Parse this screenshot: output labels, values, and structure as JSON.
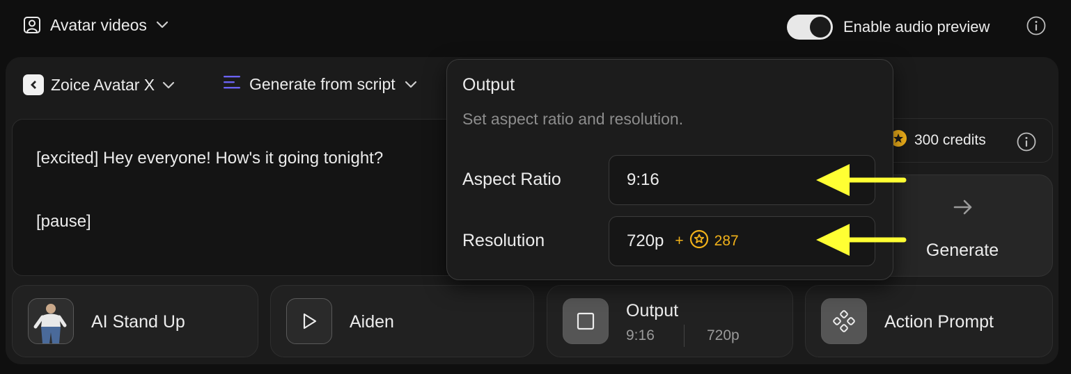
{
  "header": {
    "mode_label": "Avatar videos",
    "audio_preview_label": "Enable audio preview",
    "audio_preview_enabled": true
  },
  "toolbar": {
    "model_label": "Zoice Avatar X",
    "script_mode_label": "Generate from script"
  },
  "script": {
    "line1": "[excited] Hey everyone! How's it going tonight?",
    "line2": "[pause]"
  },
  "credits": {
    "label": "300 credits"
  },
  "generate": {
    "label": "Generate"
  },
  "cards": {
    "stand_up": {
      "label": "AI Stand Up"
    },
    "voice": {
      "label": "Aiden"
    },
    "output": {
      "label": "Output",
      "aspect": "9:16",
      "resolution": "720p"
    },
    "action": {
      "label": "Action Prompt"
    }
  },
  "popover": {
    "title": "Output",
    "description": "Set aspect ratio and resolution.",
    "aspect_label": "Aspect Ratio",
    "aspect_value": "9:16",
    "resolution_label": "Resolution",
    "resolution_value": "720p",
    "resolution_plus": "+",
    "resolution_cost": "287"
  },
  "colors": {
    "accent_yellow": "#f2b21a",
    "annotation_arrow": "#ffff33",
    "script_icon": "#6b63f5"
  }
}
